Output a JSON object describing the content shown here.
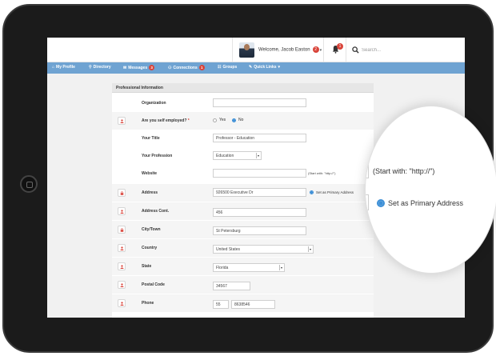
{
  "header": {
    "welcome": "Welcome, Jacob Easton",
    "welcome_badge": "2",
    "notification_badge": "1",
    "search_placeholder": "Search..."
  },
  "nav": {
    "items": [
      {
        "label": "My Profile",
        "icon": "home-icon"
      },
      {
        "label": "Directory",
        "icon": "search-icon"
      },
      {
        "label": "Messages",
        "icon": "envelope-icon",
        "badge": "3"
      },
      {
        "label": "Connections",
        "icon": "users-icon",
        "badge": "1"
      },
      {
        "label": "Groups",
        "icon": "group-icon"
      },
      {
        "label": "Quick Links",
        "icon": "wrench-icon",
        "caret": "▾"
      }
    ]
  },
  "panel": {
    "title": "Professional Information",
    "fields": {
      "organization": {
        "label": "Organization",
        "value": ""
      },
      "self_employed": {
        "label": "Are you self employed?",
        "required": "*",
        "option_yes": "Yes",
        "option_no": "No",
        "selected": "No"
      },
      "title": {
        "label": "Your Title",
        "value": "Professor - Education"
      },
      "profession": {
        "label": "Your Profession",
        "value": "Education"
      },
      "website": {
        "label": "Website",
        "value": "",
        "hint": "(Start with: \"http://\")"
      },
      "address": {
        "label": "Address",
        "value": "926500 Executive Dr",
        "primary_label": "Set as Primary Address"
      },
      "address_cont": {
        "label": "Address Cont.",
        "value": "456"
      },
      "city": {
        "label": "City/Town",
        "value": "St Petersburg"
      },
      "country": {
        "label": "Country",
        "value": "United States"
      },
      "state": {
        "label": "State",
        "value": "Florida"
      },
      "postal": {
        "label": "Postal Code",
        "value": "34567"
      },
      "phone": {
        "label": "Phone",
        "area": "55",
        "number": "8638546"
      }
    }
  },
  "magnifier": {
    "hint": "(Start with: \"http://\")",
    "primary_label": "Set as Primary Address"
  },
  "colors": {
    "nav_bg": "#6fa3d2",
    "badge": "#d9443a",
    "radio_active": "#3d8fd6",
    "privacy_icon": "#d9443a"
  }
}
